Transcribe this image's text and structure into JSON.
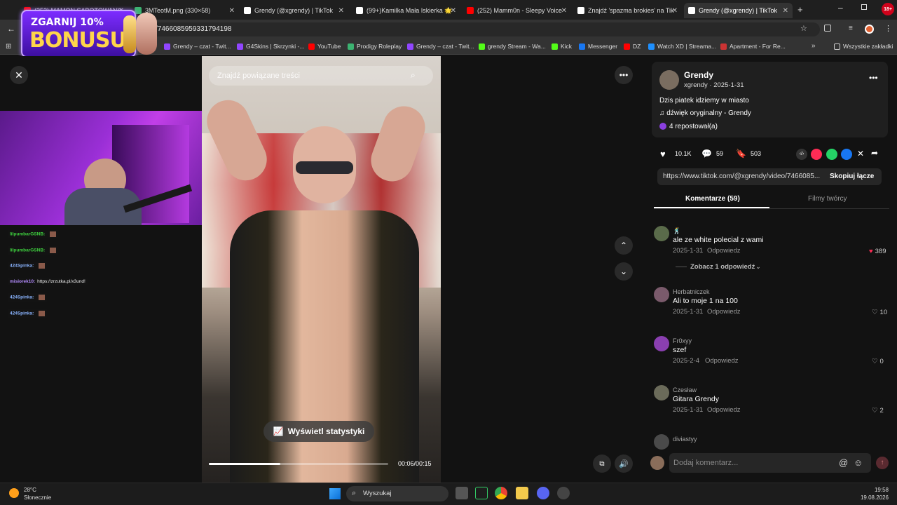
{
  "browser": {
    "tabs": [
      {
        "title": "(252) MAMON SABOTOWANY",
        "color": "#ff0000"
      },
      {
        "title": "3MTeotM.png (330×58)",
        "color": "#3cb371"
      },
      {
        "title": "Grendy (@xgrendy) | TikTok",
        "color": "#ffffff"
      },
      {
        "title": "(99+)Kamilka Mała Iskierka 🌟",
        "color": "#ffffff"
      },
      {
        "title": "(252) Mamm0n - Sleepy Voice",
        "color": "#ff0000"
      },
      {
        "title": "Znajdź 'spazma brokies' na Tik",
        "color": "#ffffff"
      },
      {
        "title": "Grendy (@xgrendy) | TikTok",
        "color": "#ffffff"
      }
    ],
    "new_tab": "+",
    "url": "/7466085959331794198",
    "bookmarks": [
      "Grendy – czat - Twit...",
      "G4Skins | Skrzynki -...",
      "YouTube",
      "Prodigy Roleplay",
      "Grendy – czat - Twit...",
      "grendy Stream - Wa...",
      "Kick",
      "Messenger",
      "DZ",
      "Watch XD | Streama...",
      "Apartment - For Re..."
    ],
    "all_bookmarks": "Wszystkie zakładki"
  },
  "ad": {
    "line1": "ZGARNIJ 10%",
    "line2": "BONUSU",
    "badge": "18+"
  },
  "video": {
    "search_placeholder": "Znajdź powiązane treści",
    "stats_button": "Wyświetl statystyki",
    "time": "00:06/00:15",
    "progress": 0.4
  },
  "chat": [
    {
      "user": "lilpumbarGSNB:",
      "msg": "",
      "color": "#3ecf3e"
    },
    {
      "user": "lilpumbarGSNB:",
      "msg": "",
      "color": "#3ecf3e"
    },
    {
      "user": "424Spinka:",
      "msg": "",
      "color": "#8ab4ff"
    },
    {
      "user": "misiorek10:",
      "msg": "https://zrzutka.pl/x3und!",
      "color": "#b48cff"
    },
    {
      "user": "424Spinka:",
      "msg": "",
      "color": "#8ab4ff"
    },
    {
      "user": "424Spinka:",
      "msg": "",
      "color": "#8ab4ff"
    }
  ],
  "post": {
    "author": "Grendy",
    "handle_date": "xgrendy · 2025-1-31",
    "description": "Dzis piatek idziemy w miasto",
    "sound": "dźwięk oryginalny - Grendy",
    "reposts": "4 repostował(a)",
    "likes": "10.1K",
    "comments": "59",
    "saves": "503",
    "link": "https://www.tiktok.com/@xgrendy/video/7466085...",
    "copy_link": "Skopiuj łącze",
    "tab_comments": "Komentarze (59)",
    "tab_creator": "Filmy twórcy"
  },
  "comments": [
    {
      "name": "🕺",
      "text": "ale ze white polecial z wami",
      "date": "2025-1-31",
      "reply": "Odpowiedz",
      "likes": "389",
      "liked": true,
      "more": "Zobacz 1 odpowiedź",
      "avatar": "#5a6b4a"
    },
    {
      "name": "Herbatniczek",
      "text": "Ali to moje 1 na 100",
      "date": "2025-1-31",
      "reply": "Odpowiedz",
      "likes": "10",
      "liked": false,
      "avatar": "#7a5a6b"
    },
    {
      "name": "Fr0xyy",
      "text": "szef",
      "date": "2025-2-4",
      "reply": "Odpowiedz",
      "likes": "0",
      "liked": false,
      "avatar": "#8a3fb0"
    },
    {
      "name": "Czesław",
      "text": "Gitara Grendy",
      "date": "2025-1-31",
      "reply": "Odpowiedz",
      "likes": "2",
      "liked": false,
      "avatar": "#6b6b5a"
    },
    {
      "name": "diviastyy",
      "text": "",
      "date": "",
      "reply": "",
      "likes": "",
      "liked": false,
      "avatar": "#4a4a4a"
    }
  ],
  "comment_input": {
    "placeholder": "Dodaj komentarz..."
  },
  "taskbar": {
    "temp": "28°C",
    "weather": "Słonecznie",
    "search": "Wyszukaj",
    "time": "19:58",
    "date": "19.08.2026"
  }
}
